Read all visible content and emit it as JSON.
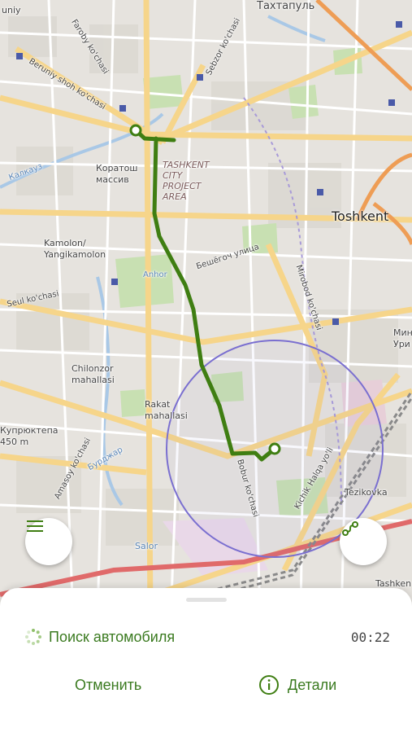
{
  "map": {
    "labels": {
      "top_street": "Тахтапуль",
      "uniy": "uniy",
      "faroby": "Faroby ko'chasi",
      "sebzor": "Sebzor ko'chasi",
      "beruniy": "Beruniy shoh ko'chasi",
      "karatosh": "Коратош\nмассив",
      "project_area": "TASHKENT\nCITY\nPROJECT\nAREA",
      "toshkent": "Toshkent",
      "kamolon": "Kamolon/\nYangikamolon",
      "beshegoch": "Бешёгоч улица",
      "seul": "Seul ko'chasi",
      "anhor": "Anhor",
      "mirobod": "Mirobod ko'chasi",
      "chilonzor": "Chilonzor\nmahallasi",
      "rakat": "Rakat\nmahallasi",
      "kupriktepa": "Купрюктепа\n450 m",
      "amasoy": "Amasoy ko'chasi",
      "bobur": "Bobur ko'chasi",
      "tezikovka": "Tezikovka",
      "kichik_halqa": "Kichik Halqa yo'li",
      "salor": "Salor",
      "tashkent_edge": "Tashken",
      "minor_edge": "Мин\nУри",
      "kalkauz": "Калкауз",
      "burjar": "Бурджар"
    },
    "route_color": "#3f7e12",
    "radius_color": "#7a6fd0"
  },
  "controls": {
    "menu_icon": "menu-icon",
    "route_icon": "route-icon"
  },
  "sheet": {
    "status": "Поиск автомобиля",
    "timer": "00:22",
    "cancel_label": "Отменить",
    "details_label": "Детали"
  }
}
